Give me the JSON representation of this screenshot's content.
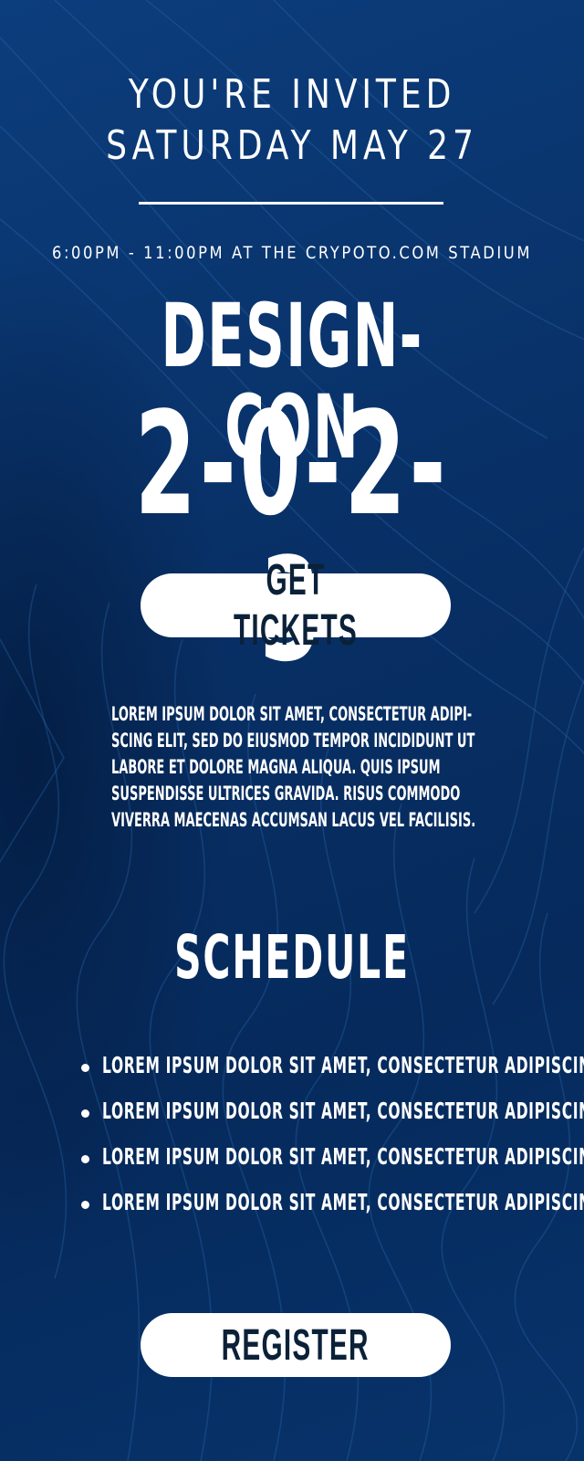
{
  "header": {
    "invited": "YOU'RE INVITED",
    "date": "SATURDAY MAY 27"
  },
  "event": {
    "time_venue": "6:00PM - 11:00PM AT THE CRYPOTO.COM STADIUM",
    "title": "DESIGN-CON",
    "year": "2-0-2-3"
  },
  "buttons": {
    "tickets": "GET TICKETS",
    "register": "REGISTER"
  },
  "description": "LOREM IPSUM DOLOR SIT AMET, CONSECTETUR ADIPI-SCING ELIT, SED DO EIUSMOD TEMPOR INCIDIDUNT UT LABORE ET DOLORE MAGNA ALIQUA. QUIS IPSUM SUSPENDISSE ULTRICES GRAVIDA. RISUS COMMODO VIVERRA MAECENAS ACCUMSAN LACUS VEL FACILISIS.",
  "schedule": {
    "heading": "SCHEDULE",
    "items": [
      "LOREM IPSUM DOLOR SIT AMET, CONSECTETUR ADIPISCING",
      "LOREM IPSUM DOLOR SIT AMET, CONSECTETUR ADIPISCING",
      "LOREM IPSUM DOLOR SIT AMET, CONSECTETUR ADIPISCING",
      "LOREM IPSUM DOLOR SIT AMET, CONSECTETUR ADIPISCING"
    ]
  },
  "colors": {
    "background": "#0a3570",
    "text": "#ffffff",
    "button_bg": "#ffffff",
    "button_text": "#0b2138"
  }
}
